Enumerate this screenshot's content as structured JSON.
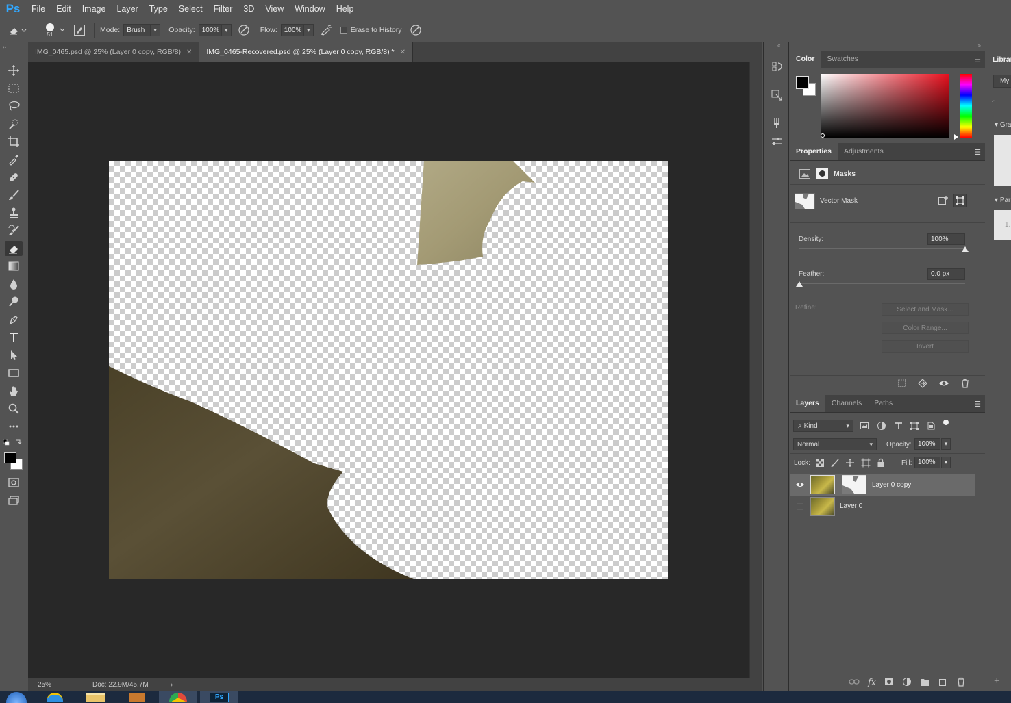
{
  "app": {
    "logo": "Ps"
  },
  "menu": [
    "File",
    "Edit",
    "Image",
    "Layer",
    "Type",
    "Select",
    "Filter",
    "3D",
    "View",
    "Window",
    "Help"
  ],
  "options": {
    "brush_size": "51",
    "mode_label": "Mode:",
    "mode_value": "Brush",
    "opacity_label": "Opacity:",
    "opacity_value": "100%",
    "flow_label": "Flow:",
    "flow_value": "100%",
    "erase_history_label": "Erase to History"
  },
  "tabs": [
    {
      "label": "IMG_0465.psd @ 25% (Layer 0 copy, RGB/8)",
      "active": false
    },
    {
      "label": "IMG_0465-Recovered.psd @ 25% (Layer 0 copy, RGB/8) *",
      "active": true
    }
  ],
  "status": {
    "zoom": "25%",
    "doc": "Doc: 22.9M/45.7M"
  },
  "color_panel": {
    "tabs": [
      "Color",
      "Swatches"
    ],
    "foreground": "#000000",
    "background": "#ffffff"
  },
  "properties_panel": {
    "tabs": [
      "Properties",
      "Adjustments"
    ],
    "section": "Masks",
    "mask_type": "Vector Mask",
    "density_label": "Density:",
    "density_value": "100%",
    "density_level": 1.0,
    "feather_label": "Feather:",
    "feather_value": "0.0 px",
    "feather_level": 0.0,
    "refine_label": "Refine:",
    "buttons": [
      "Select and Mask...",
      "Color Range...",
      "Invert"
    ]
  },
  "layers_panel": {
    "tabs": [
      "Layers",
      "Channels",
      "Paths"
    ],
    "filter_kind": "Kind",
    "blend_mode": "Normal",
    "opacity_label": "Opacity:",
    "opacity_value": "100%",
    "lock_label": "Lock:",
    "fill_label": "Fill:",
    "fill_value": "100%",
    "layers": [
      {
        "name": "Layer 0 copy",
        "visible": true,
        "selected": true
      },
      {
        "name": "Layer 0",
        "visible": false,
        "selected": false
      }
    ]
  },
  "libraries": {
    "title": "Librar",
    "my": "My",
    "gr": "Gra",
    "pa": "Par",
    "num": "1."
  }
}
